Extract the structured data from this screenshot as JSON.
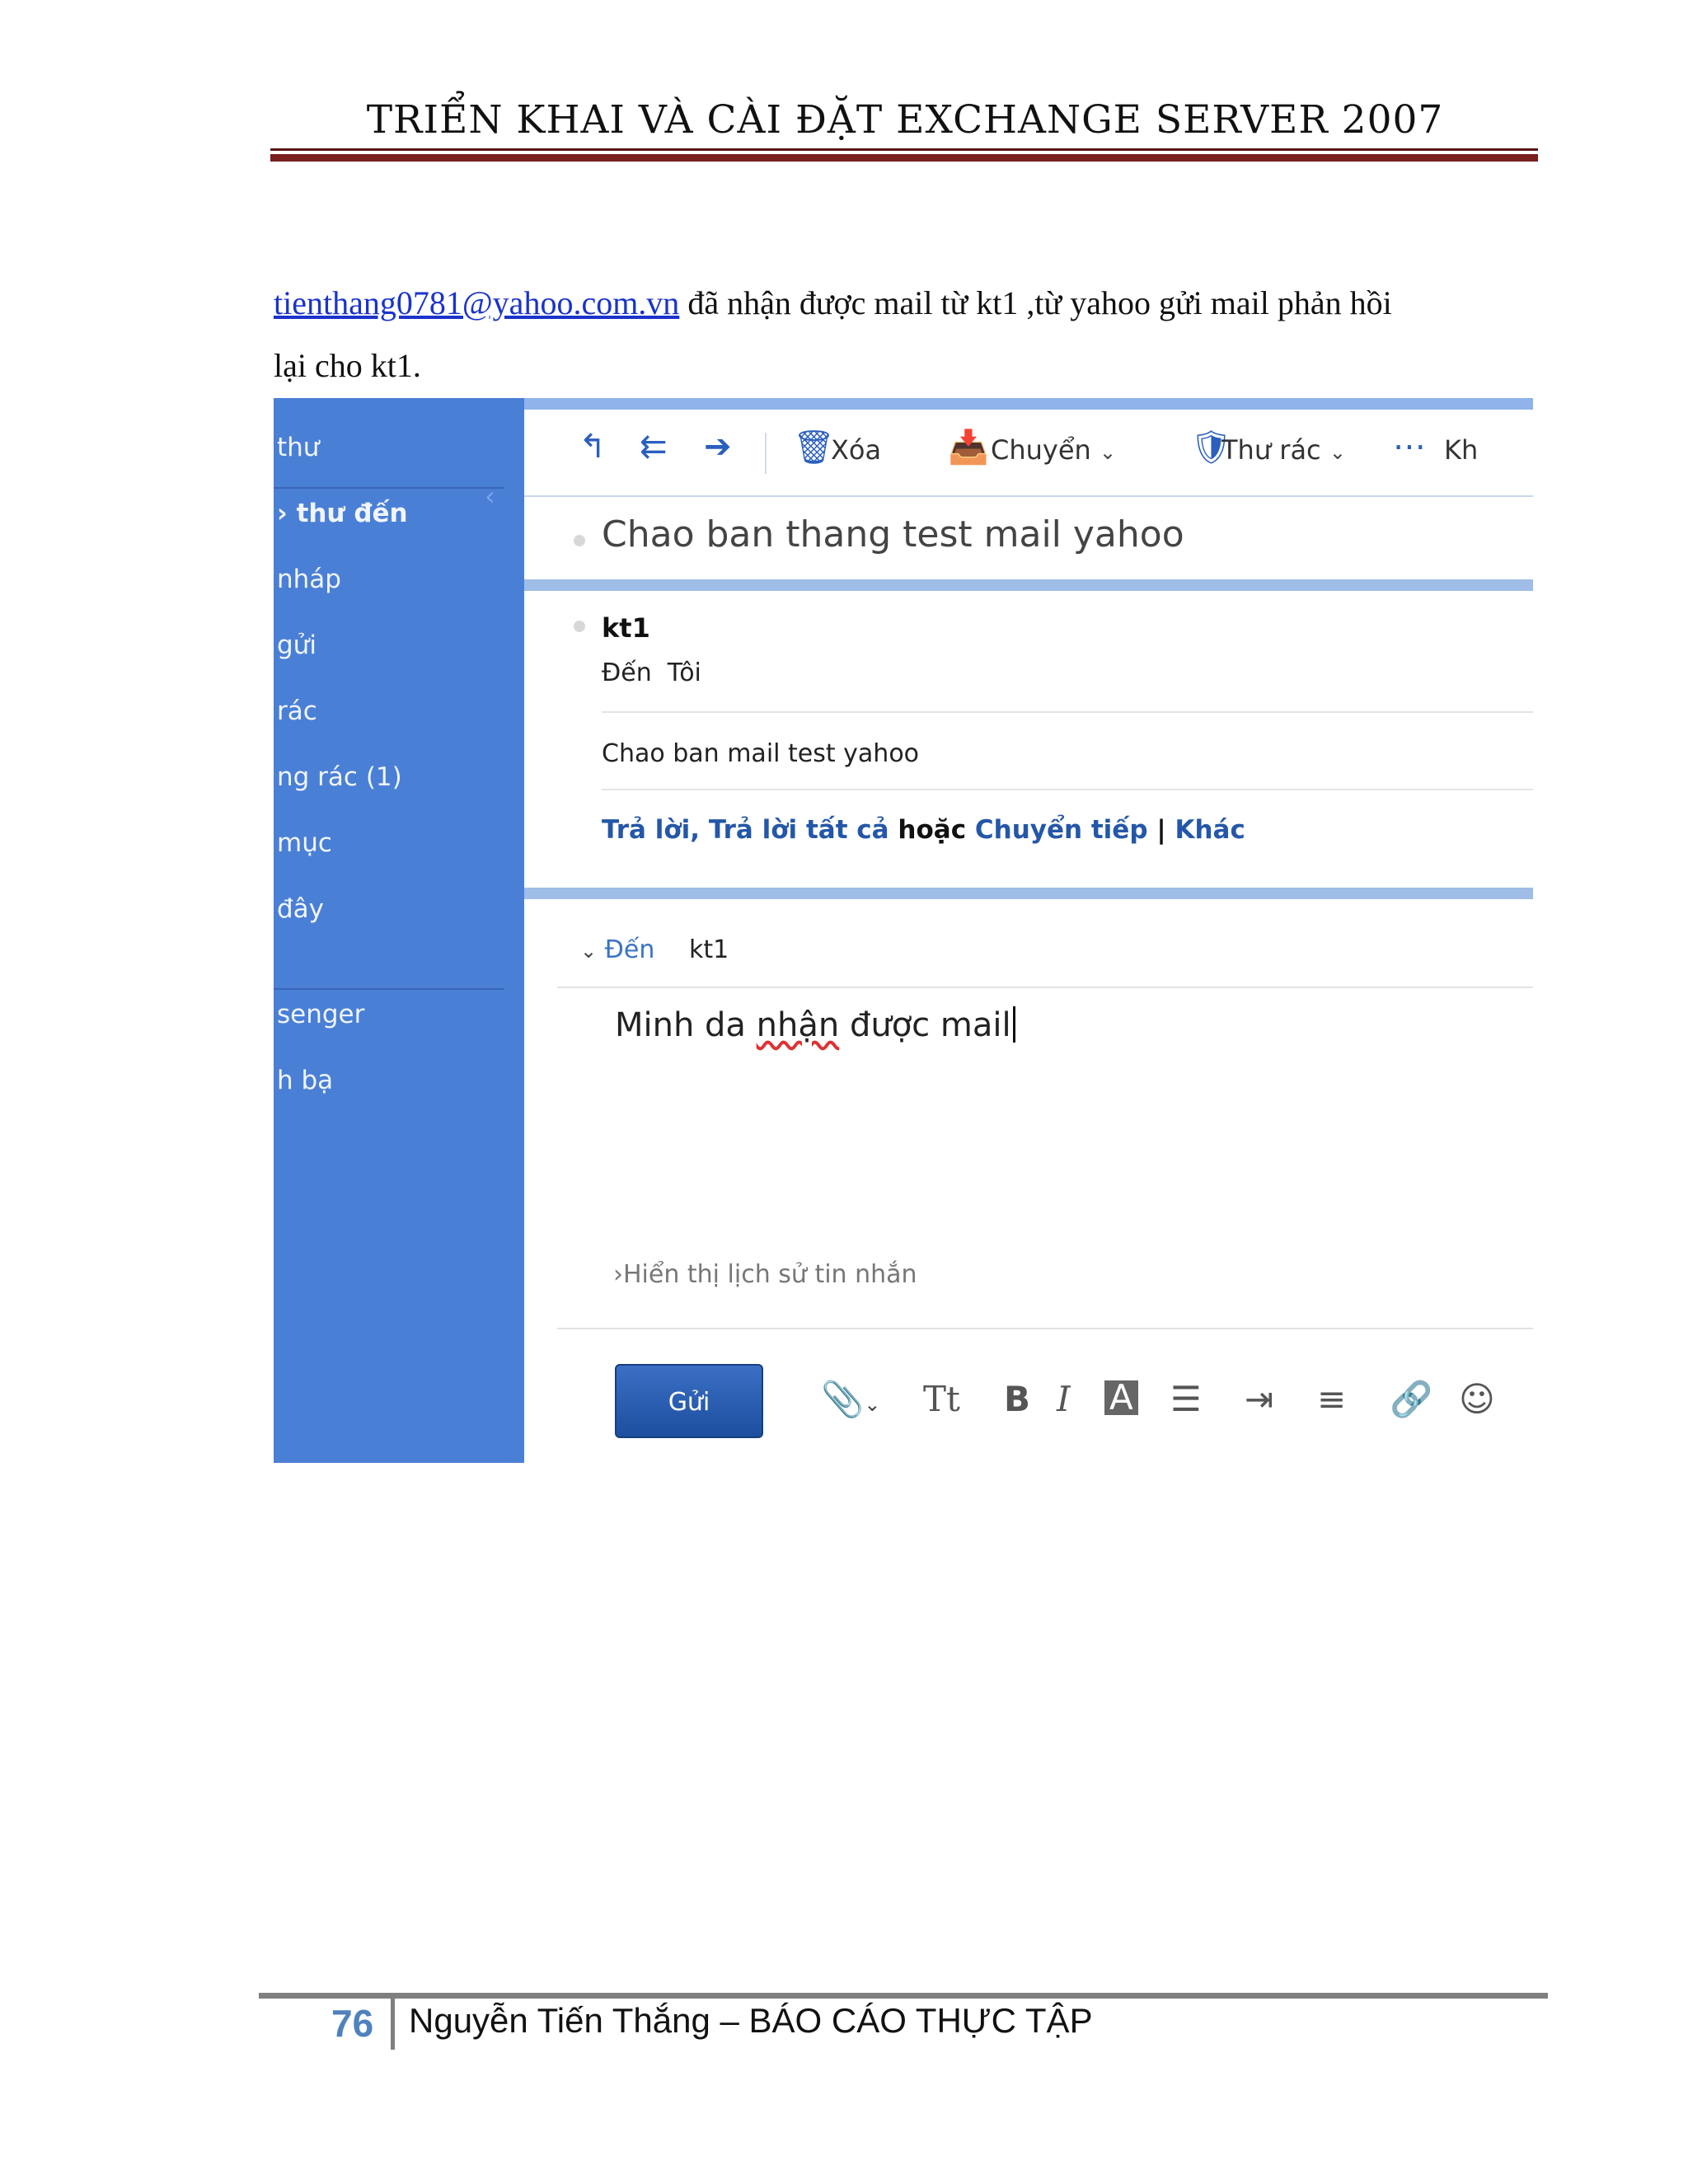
{
  "header": {
    "title": "TRIỂN KHAI VÀ CÀI ĐẶT EXCHANGE SERVER 2007"
  },
  "paragraph": {
    "email_link": "tienthang0781@yahoo.com.vn",
    "text_line1": " đã nhận được mail từ kt1 ,từ yahoo gửi mail phản hồi",
    "text_line2": "lại cho kt1."
  },
  "screenshot": {
    "sidebar": {
      "items": [
        "thư",
        "thư đến",
        "nháp",
        "gửi",
        "rác",
        "ng rác (1)",
        "mục",
        "đây",
        "senger",
        "h bạ"
      ]
    },
    "toolbar": {
      "icons": [
        "reply-icon",
        "reply-all-icon",
        "forward-icon",
        "trash-icon",
        "move-icon",
        "spam-shield-icon",
        "more-icon"
      ],
      "delete_label": "Xóa",
      "move_label": "Chuyển",
      "spam_label": "Thư rác",
      "more_label": "Kh"
    },
    "subject": "Chao ban thang test mail yahoo",
    "message": {
      "sender": "kt1",
      "to_label": "Đến",
      "to_value": "Tôi",
      "body": "Chao ban mail test yahoo",
      "reply": "Trả lời,",
      "reply_all": "Trả lời tất cả",
      "or": "hoặc",
      "forward": "Chuyển tiếp",
      "separator": "|",
      "other": "Khác"
    },
    "compose": {
      "to_label": "Đến",
      "to_value": "kt1",
      "draft_part1": "Minh da ",
      "draft_misspelled": "nhận",
      "draft_part2": " được mail",
      "show_history": "Hiển thị lịch sử tin nhắn",
      "send_button": "Gửi",
      "format_icons": [
        "attach-icon",
        "text-size-icon",
        "bold-icon",
        "italic-icon",
        "text-color-icon",
        "bullet-list-icon",
        "indent-icon",
        "align-icon",
        "link-icon",
        "emoji-icon"
      ]
    }
  },
  "footer": {
    "page_number": "76",
    "text": "Nguyễn Tiến Thắng – BÁO CÁO THỰC TẬP"
  }
}
